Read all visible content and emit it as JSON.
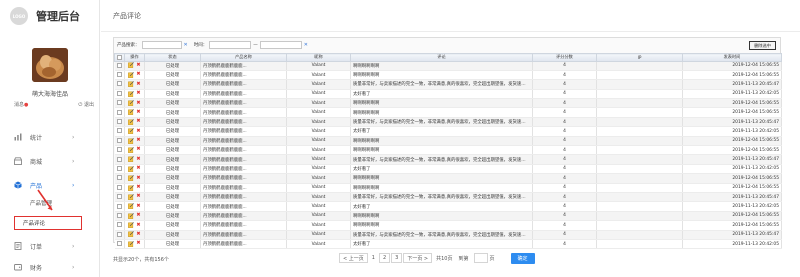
{
  "app": {
    "logo_text": "LOGO",
    "title": "管理后台"
  },
  "user": {
    "name": "萌大海海佳品",
    "message_label": "消息",
    "logout_label": "退出"
  },
  "nav": [
    {
      "key": "stats",
      "label": "统计"
    },
    {
      "key": "store",
      "label": "商城"
    },
    {
      "key": "product",
      "label": "产品",
      "active": true
    },
    {
      "key": "order",
      "label": "订单"
    },
    {
      "key": "finance",
      "label": "财务"
    }
  ],
  "nav_sub": {
    "product_mgmt": "产品管理",
    "product_review": "产品评论"
  },
  "page": {
    "title": "产品评论"
  },
  "filters": {
    "product_label": "产品搜索：",
    "time_label": "时间：",
    "dash": "—",
    "clear": "✕",
    "export_label": "删除选中"
  },
  "columns": [
    "操作",
    "状态",
    "产品名称",
    "昵称",
    "评论",
    "评分分数",
    "IP",
    "发表时间"
  ],
  "rows": [
    {
      "status": "已处理",
      "product": "丹顶鹤鹤鹿鹿鹤鹿鹿...",
      "nick": "Valant",
      "comment": "啊啊啊啊啊啊",
      "score": "4",
      "ip": "",
      "time": "2019-12-04 15:06:55"
    },
    {
      "status": "已处理",
      "product": "丹顶鹤鹤鹿鹿鹤鹿鹿...",
      "nick": "Valant",
      "comment": "啊啊啊啊啊啊",
      "score": "4",
      "ip": "",
      "time": "2019-12-04 15:06:55"
    },
    {
      "status": "已处理",
      "product": "丹顶鹤鹤鹿鹿鹤鹿鹿...",
      "nick": "Valant",
      "comment": "质量非常好，与卖家描述的完全一致，非常满意,真的很喜欢，完全超出期望值，发货速度非常...",
      "score": "4",
      "ip": "",
      "time": "2019-11-13 20:45:47"
    },
    {
      "status": "已处理",
      "product": "丹顶鹤鹤鹿鹿鹤鹿鹿...",
      "nick": "Valant",
      "comment": "太好看了",
      "score": "4",
      "ip": "",
      "time": "2019-11-13 20:42:05"
    },
    {
      "status": "已处理",
      "product": "丹顶鹤鹤鹿鹿鹤鹿鹿...",
      "nick": "Valant",
      "comment": "啊啊啊啊啊啊",
      "score": "4",
      "ip": "",
      "time": "2019-12-04 15:06:55"
    },
    {
      "status": "已处理",
      "product": "丹顶鹤鹤鹿鹿鹤鹿鹿...",
      "nick": "Valant",
      "comment": "啊啊啊啊啊啊",
      "score": "4",
      "ip": "",
      "time": "2019-12-04 15:06:55"
    },
    {
      "status": "已处理",
      "product": "丹顶鹤鹤鹿鹿鹤鹿鹿...",
      "nick": "Valant",
      "comment": "质量非常好，与卖家描述的完全一致，非常满意,真的很喜欢，完全超出期望值，发货速度非常...",
      "score": "4",
      "ip": "",
      "time": "2019-11-13 20:45:47"
    },
    {
      "status": "已处理",
      "product": "丹顶鹤鹤鹿鹿鹤鹿鹿...",
      "nick": "Valant",
      "comment": "太好看了",
      "score": "4",
      "ip": "",
      "time": "2019-11-13 20:42:05"
    },
    {
      "status": "已处理",
      "product": "丹顶鹤鹤鹿鹿鹤鹿鹿...",
      "nick": "Valant",
      "comment": "啊啊啊啊啊啊",
      "score": "4",
      "ip": "",
      "time": "2019-12-04 15:06:55"
    },
    {
      "status": "已处理",
      "product": "丹顶鹤鹤鹿鹿鹤鹿鹿...",
      "nick": "Valant",
      "comment": "啊啊啊啊啊啊",
      "score": "4",
      "ip": "",
      "time": "2019-12-04 15:06:55"
    },
    {
      "status": "已处理",
      "product": "丹顶鹤鹤鹿鹿鹤鹿鹿...",
      "nick": "Valant",
      "comment": "质量非常好，与卖家描述的完全一致，非常满意,真的很喜欢，完全超出期望值，发货速度非常...",
      "score": "4",
      "ip": "",
      "time": "2019-11-13 20:45:47"
    },
    {
      "status": "已处理",
      "product": "丹顶鹤鹤鹿鹿鹤鹿鹿...",
      "nick": "Valant",
      "comment": "太好看了",
      "score": "4",
      "ip": "",
      "time": "2019-11-13 20:42:05"
    },
    {
      "status": "已处理",
      "product": "丹顶鹤鹤鹿鹿鹤鹿鹿...",
      "nick": "Valant",
      "comment": "啊啊啊啊啊啊",
      "score": "4",
      "ip": "",
      "time": "2019-12-04 15:06:55"
    },
    {
      "status": "已处理",
      "product": "丹顶鹤鹤鹿鹿鹤鹿鹿...",
      "nick": "Valant",
      "comment": "啊啊啊啊啊啊",
      "score": "4",
      "ip": "",
      "time": "2019-12-04 15:06:55"
    },
    {
      "status": "已处理",
      "product": "丹顶鹤鹤鹿鹿鹤鹿鹿...",
      "nick": "Valant",
      "comment": "质量非常好，与卖家描述的完全一致，非常满意,真的很喜欢，完全超出期望值，发货速度非常...",
      "score": "4",
      "ip": "",
      "time": "2019-11-13 20:45:47"
    },
    {
      "status": "已处理",
      "product": "丹顶鹤鹤鹿鹿鹤鹿鹿...",
      "nick": "Valant",
      "comment": "太好看了",
      "score": "4",
      "ip": "",
      "time": "2019-11-13 20:42:05"
    },
    {
      "status": "已处理",
      "product": "丹顶鹤鹤鹿鹿鹤鹿鹿...",
      "nick": "Valant",
      "comment": "啊啊啊啊啊啊",
      "score": "4",
      "ip": "",
      "time": "2019-12-04 15:06:55"
    },
    {
      "status": "已处理",
      "product": "丹顶鹤鹤鹿鹿鹤鹿鹿...",
      "nick": "Valant",
      "comment": "啊啊啊啊啊啊",
      "score": "4",
      "ip": "",
      "time": "2019-12-04 15:06:55"
    },
    {
      "status": "已处理",
      "product": "丹顶鹤鹤鹿鹿鹤鹿鹿...",
      "nick": "Valant",
      "comment": "质量非常好，与卖家描述的完全一致，非常满意,真的很喜欢，完全超出期望值，发货速度非常...",
      "score": "4",
      "ip": "",
      "time": "2019-11-13 20:45:47"
    },
    {
      "status": "已处理",
      "product": "丹顶鹤鹤鹿鹿鹤鹿鹿...",
      "nick": "Valant",
      "comment": "太好看了",
      "score": "4",
      "ip": "",
      "time": "2019-11-13 20:42:05"
    }
  ],
  "footer": {
    "records_text": "共显示20个，共有156个",
    "prev_label": "< 上一页",
    "pages": [
      "1",
      "2",
      "3"
    ],
    "next_label": "下一页 >",
    "total_pages": "共10页",
    "goto_label": "到第",
    "page_unit": "页",
    "confirm_label": "确定"
  },
  "colors": {
    "accent": "#2d8cf0",
    "danger": "#e2302c",
    "nav_active": "#1f6fd6"
  }
}
